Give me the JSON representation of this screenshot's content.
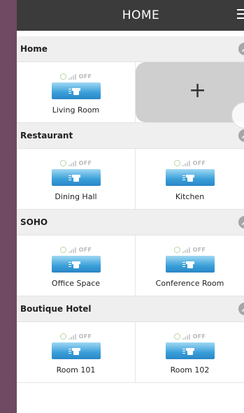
{
  "header": {
    "title": "HOME",
    "menu_icon": "hamburger-menu-icon"
  },
  "add_tile": {
    "symbol": "+"
  },
  "sections": [
    {
      "name": "Home",
      "rooms": [
        {
          "name": "Living Room",
          "status": "OFF"
        }
      ]
    },
    {
      "name": "Restaurant",
      "rooms": [
        {
          "name": "Dining Hall",
          "status": "OFF"
        },
        {
          "name": "Kitchen",
          "status": "OFF"
        }
      ]
    },
    {
      "name": "SOHO",
      "rooms": [
        {
          "name": "Office Space",
          "status": "OFF"
        },
        {
          "name": "Conference Room",
          "status": "OFF"
        }
      ]
    },
    {
      "name": "Boutique Hotel",
      "rooms": [
        {
          "name": "Room 101",
          "status": "OFF"
        },
        {
          "name": "Room 102",
          "status": "OFF"
        }
      ]
    }
  ],
  "colors": {
    "header_bg": "#3b3b3b",
    "section_bg": "#efefef",
    "device_blue": "#3a9fd9",
    "rail": "#6f4a62"
  }
}
